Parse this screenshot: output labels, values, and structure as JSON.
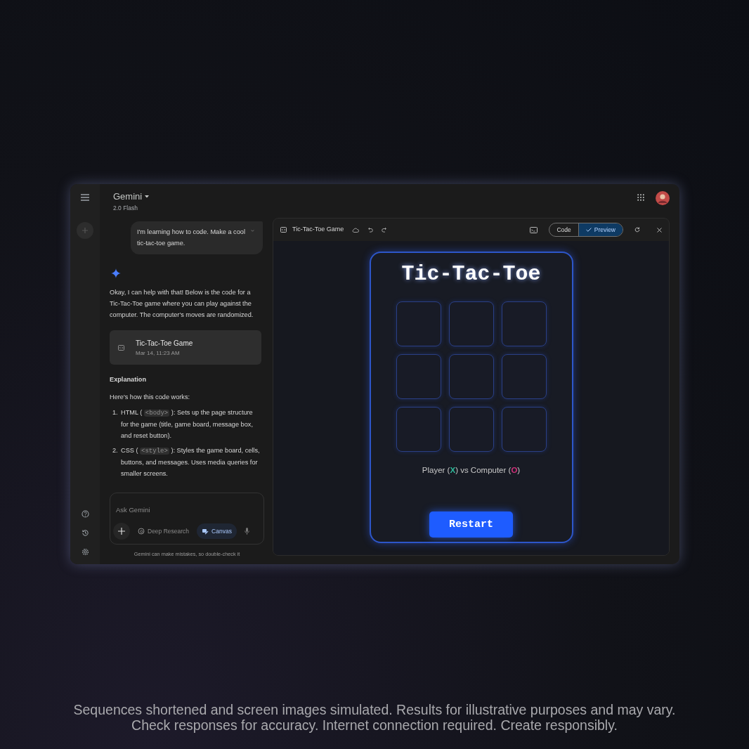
{
  "header": {
    "title": "Gemini",
    "model": "2.0 Flash"
  },
  "user_message": {
    "text": "I'm learning how to code. Make a cool tic-tac-toe game."
  },
  "reply": {
    "intro": "Okay, I can help with that! Below is the code for a Tic-Tac-Toe game where you can play against the computer. The computer's moves are randomized.",
    "artifact": {
      "title": "Tic-Tac-Toe Game",
      "date": "Mar 14, 11:23 AM"
    },
    "heading": "Explanation",
    "lead": "Here's how this code works:",
    "steps": [
      {
        "marker": "1.",
        "parts": [
          {
            "kind": "text",
            "text": "HTML ( "
          },
          {
            "kind": "code",
            "text": "<body>"
          },
          {
            "kind": "text",
            "text": " ): Sets up the page structure for the game (title, game board, message box, and reset button)."
          }
        ]
      },
      {
        "marker": "2.",
        "parts": [
          {
            "kind": "text",
            "text": "CSS ( "
          },
          {
            "kind": "code",
            "text": "<style>"
          },
          {
            "kind": "text",
            "text": " ): Styles the game board, cells, buttons, and messages. Uses media queries for smaller screens."
          }
        ]
      }
    ]
  },
  "composer": {
    "placeholder": "Ask Gemini",
    "tools": [
      {
        "label": "Deep Research",
        "selected": false
      },
      {
        "label": "Canvas",
        "selected": true
      }
    ]
  },
  "disclaimer": "Gemini can make mistakes, so double-check it",
  "canvas": {
    "title": "Tic-Tac-Toe Game",
    "views": [
      {
        "label": "Code",
        "selected": false
      },
      {
        "label": "Preview",
        "selected": true
      }
    ],
    "game": {
      "title": "Tic-Tac-Toe",
      "status": [
        {
          "text": "Player ("
        },
        {
          "text": "X",
          "color": "#2fb89a"
        },
        {
          "text": ") vs Computer ("
        },
        {
          "text": "O",
          "color": "#d0317a"
        },
        {
          "text": ")"
        }
      ],
      "button": "Restart"
    }
  },
  "caption": [
    "Sequences shortened and screen images simulated. Results for illustrative purposes and may vary.",
    "Check responses for accuracy. Internet connection required. Create responsibly."
  ]
}
